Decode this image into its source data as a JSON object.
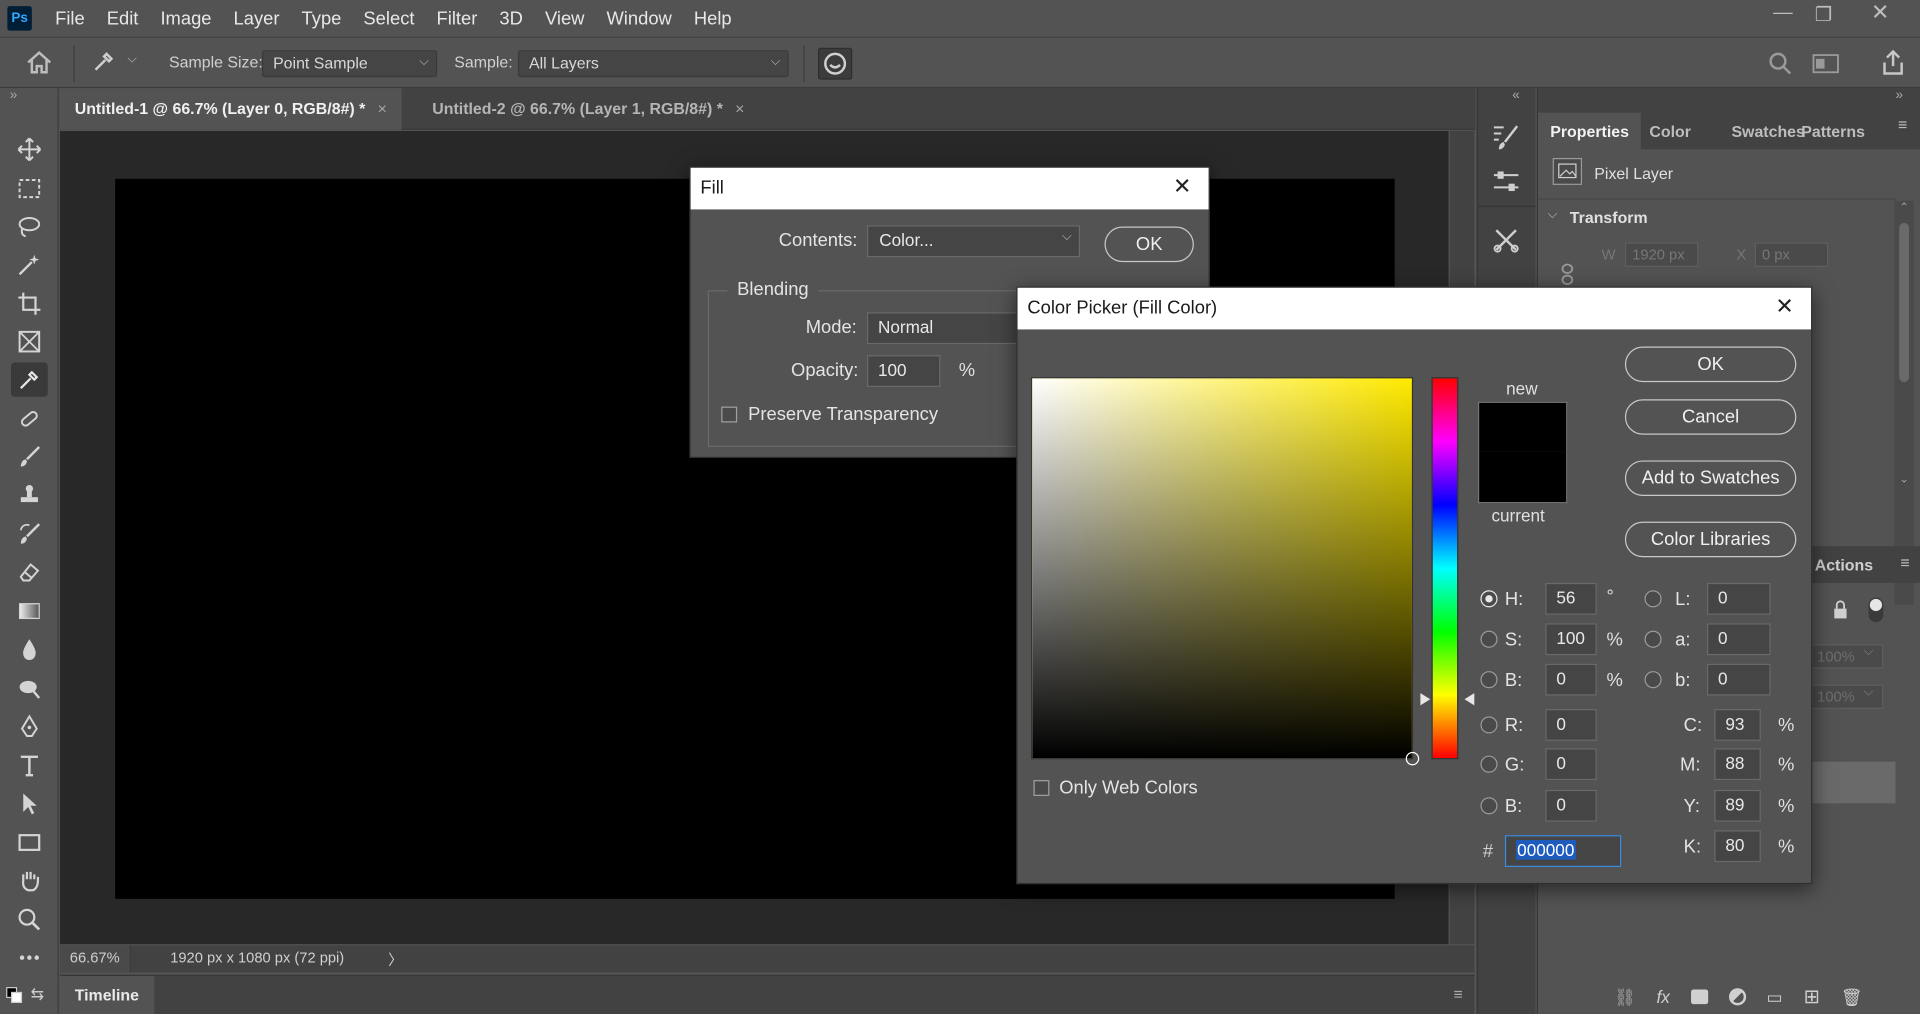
{
  "app": {
    "logo": "Ps",
    "menu": [
      "File",
      "Edit",
      "Image",
      "Layer",
      "Type",
      "Select",
      "Filter",
      "3D",
      "View",
      "Window",
      "Help"
    ],
    "window_controls": [
      "minimize-icon",
      "restore-icon",
      "close-icon"
    ]
  },
  "options_bar": {
    "sample_size_label": "Sample Size:",
    "sample_size_value": "Point Sample",
    "sample_label": "Sample:",
    "sample_value": "All Layers"
  },
  "tools": [
    "move-icon",
    "marquee-icon",
    "lasso-icon",
    "magic-wand-icon",
    "crop-icon",
    "frame-icon",
    "eyedropper-icon",
    "healing-brush-icon",
    "brush-icon",
    "clone-stamp-icon",
    "history-brush-icon",
    "eraser-icon",
    "gradient-icon",
    "blur-icon",
    "dodge-icon",
    "pen-icon",
    "type-icon",
    "path-selection-icon",
    "rectangle-icon",
    "hand-icon",
    "zoom-icon",
    "more-tools-icon"
  ],
  "tabs": [
    {
      "label": "Untitled-1 @ 66.7% (Layer 0, RGB/8#) *",
      "close": "×"
    },
    {
      "label": "Untitled-2 @ 66.7% (Layer 1, RGB/8#) *",
      "close": "×"
    }
  ],
  "status": {
    "zoom": "66.67%",
    "doc_info": "1920 px x 1080 px (72 ppi)",
    "arrow": "〉"
  },
  "timeline": {
    "label": "Timeline"
  },
  "panels": {
    "tabs": [
      "Properties",
      "Color",
      "Swatches",
      "Patterns"
    ],
    "layer_kind": "Pixel Layer",
    "transform_label": "Transform",
    "w_label": "W",
    "w_value": "1920 px",
    "x_label": "X",
    "x_value": "0 px",
    "actions_tab": "Actions",
    "opacity_value": "100%",
    "fill_value": "100%"
  },
  "fill_dialog": {
    "title": "Fill",
    "contents_label": "Contents:",
    "contents_value": "Color...",
    "ok": "OK",
    "blending_label": "Blending",
    "mode_label": "Mode:",
    "mode_value": "Normal",
    "opacity_label": "Opacity:",
    "opacity_value": "100",
    "opacity_unit": "%",
    "preserve_label": "Preserve Transparency"
  },
  "color_picker": {
    "title": "Color Picker (Fill Color)",
    "new_label": "new",
    "current_label": "current",
    "ok": "OK",
    "cancel": "Cancel",
    "add_swatches": "Add to Swatches",
    "color_libraries": "Color Libraries",
    "only_web_colors": "Only Web Colors",
    "selected_hue": 56,
    "new_color": "#000000",
    "current_color": "#000000",
    "hsb": [
      {
        "label": "H:",
        "value": "56",
        "unit": "°",
        "selected": true
      },
      {
        "label": "S:",
        "value": "100",
        "unit": "%"
      },
      {
        "label": "B:",
        "value": "0",
        "unit": "%"
      }
    ],
    "rgb": [
      {
        "label": "R:",
        "value": "0"
      },
      {
        "label": "G:",
        "value": "0"
      },
      {
        "label": "B:",
        "value": "0"
      }
    ],
    "lab": [
      {
        "label": "L:",
        "value": "0"
      },
      {
        "label": "a:",
        "value": "0"
      },
      {
        "label": "b:",
        "value": "0"
      }
    ],
    "cmyk": [
      {
        "label": "C:",
        "value": "93",
        "unit": "%"
      },
      {
        "label": "M:",
        "value": "88",
        "unit": "%"
      },
      {
        "label": "Y:",
        "value": "89",
        "unit": "%"
      },
      {
        "label": "K:",
        "value": "80",
        "unit": "%"
      }
    ],
    "hex_label": "#",
    "hex_value": "000000"
  },
  "colors": {
    "hue_color": "#ffea00",
    "selection": "#1e5bbf",
    "accent": "#31a8ff"
  }
}
